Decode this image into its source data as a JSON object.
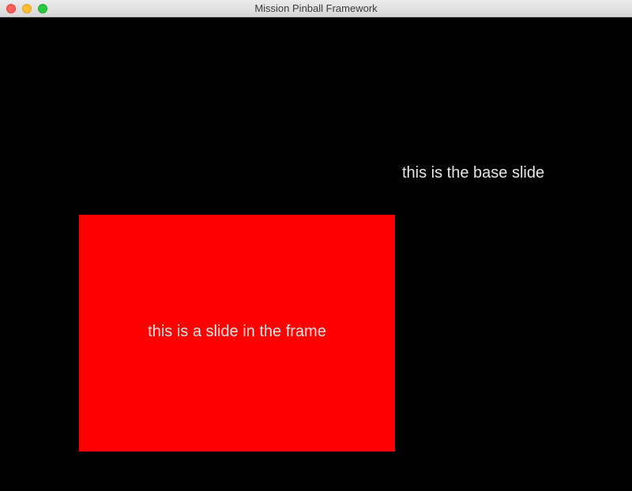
{
  "window": {
    "title": "Mission Pinball Framework",
    "controls": [
      {
        "name": "close",
        "color": "#ff5f57"
      },
      {
        "name": "minimize",
        "color": "#febc2e"
      },
      {
        "name": "zoom",
        "color": "#28c840"
      }
    ]
  },
  "base_slide": {
    "text": "this is the base slide",
    "background": "#000000",
    "text_color": "#e6e6e6"
  },
  "frame_slide": {
    "text": "this is a slide in the frame",
    "background": "#ff0000",
    "text_color": "#e6e6e6"
  }
}
